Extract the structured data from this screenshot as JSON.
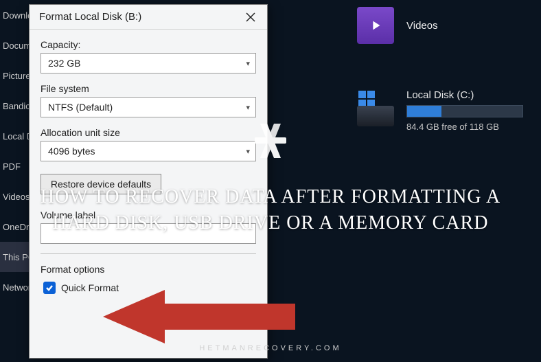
{
  "sidebar": {
    "items": [
      {
        "label": "Downloads"
      },
      {
        "label": "Documents"
      },
      {
        "label": "Pictures"
      },
      {
        "label": "Bandicam"
      },
      {
        "label": "Local Disk"
      },
      {
        "label": "PDF"
      },
      {
        "label": "Videos"
      },
      {
        "label": "OneDrive"
      },
      {
        "label": "This PC"
      },
      {
        "label": "Network"
      }
    ]
  },
  "explorer": {
    "videos_label": "Videos",
    "disk_c_name": "Local Disk (C:)",
    "disk_c_free": "84.4 GB free of 118 GB",
    "disk_c_fill_pct": 30
  },
  "dialog": {
    "title": "Format Local Disk (B:)",
    "capacity_label": "Capacity:",
    "capacity_value": "232 GB",
    "fs_label": "File system",
    "fs_value": "NTFS (Default)",
    "alloc_label": "Allocation unit size",
    "alloc_value": "4096 bytes",
    "restore_label": "Restore device defaults",
    "volume_label_caption": "Volume label",
    "volume_label_value": "",
    "options_label": "Format options",
    "quick_format_label": "Quick Format",
    "quick_format_checked": true
  },
  "overlay": {
    "headline": "HOW TO RECOVER DATA AFTER FORMATTING A HARD DISK, USB DRIVE OR A MEMORY CARD",
    "credit": "HETMANRECOVERY.COM"
  }
}
